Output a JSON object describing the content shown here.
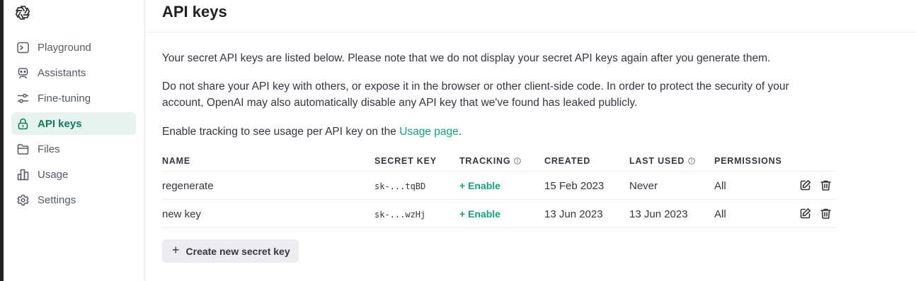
{
  "sidebar": {
    "logo_icon": "openai-logo-icon",
    "items": [
      {
        "label": "Playground",
        "icon": "terminal-icon",
        "active": false
      },
      {
        "label": "Assistants",
        "icon": "robot-icon",
        "active": false
      },
      {
        "label": "Fine-tuning",
        "icon": "sliders-icon",
        "active": false
      },
      {
        "label": "API keys",
        "icon": "lock-icon",
        "active": true
      },
      {
        "label": "Files",
        "icon": "folder-icon",
        "active": false
      },
      {
        "label": "Usage",
        "icon": "bar-chart-icon",
        "active": false
      },
      {
        "label": "Settings",
        "icon": "gear-icon",
        "active": false
      }
    ]
  },
  "header": {
    "title": "API keys"
  },
  "content": {
    "intro": "Your secret API keys are listed below. Please note that we do not display your secret API keys again after you generate them.",
    "warning": "Do not share your API key with others, or expose it in the browser or other client-side code. In order to protect the security of your account, OpenAI may also automatically disable any API key that we've found has leaked publicly.",
    "tracking_prefix": "Enable tracking to see usage per API key on the ",
    "tracking_link": "Usage page",
    "tracking_suffix": "."
  },
  "table": {
    "columns": {
      "name": "NAME",
      "secret_key": "SECRET KEY",
      "tracking": "TRACKING",
      "created": "CREATED",
      "last_used": "LAST USED",
      "permissions": "PERMISSIONS"
    },
    "rows": [
      {
        "name": "regenerate",
        "secret_key": "sk-...tqBD",
        "tracking": "+ Enable",
        "created": "15 Feb 2023",
        "last_used": "Never",
        "permissions": "All"
      },
      {
        "name": "new key",
        "secret_key": "sk-...wzHj",
        "tracking": "+ Enable",
        "created": "13 Jun 2023",
        "last_used": "13 Jun 2023",
        "permissions": "All"
      }
    ]
  },
  "create_button": {
    "icon": "+",
    "label": "Create new secret key"
  },
  "colors": {
    "accent": "#10a37f",
    "active_bg": "#e6f3ef",
    "button_bg": "#ececf1"
  }
}
